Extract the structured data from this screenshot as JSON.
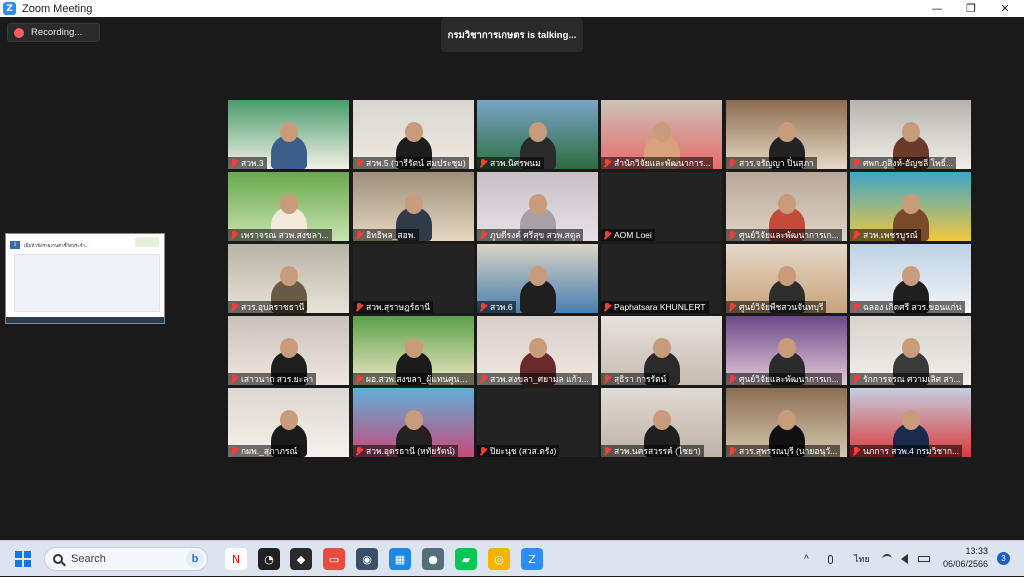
{
  "window": {
    "title": "Zoom Meeting",
    "logo_letter": "Z",
    "minimize": "—",
    "maximize": "❐",
    "close": "✕"
  },
  "recording": {
    "label": "Recording..."
  },
  "talking": {
    "text": "กรมวิชาการเกษตร is talking..."
  },
  "shared_screen": {
    "slide_number": "1",
    "slide_heading": "เพิ่มหัวข้อรายงานตัวชี้วัดประจำ..."
  },
  "tiles": [
    {
      "name": "สวพ.3"
    },
    {
      "name": "สวพ.5 (วารีรัตน์ สมประชุม)"
    },
    {
      "name": "สวพ.นิศรพนม"
    },
    {
      "name": "สำนักวิจัยและพัฒนาการ..."
    },
    {
      "name": "สวร.จรัญญา ปิ่นสุภา"
    },
    {
      "name": "ศพก.ภูสิงห์-อัญชลี โพธิ์..."
    },
    {
      "name": "เพราจรณ สวพ.สงขลา..."
    },
    {
      "name": "อิทธิพล_สอพ."
    },
    {
      "name": "ภูบดีรงค์ ศรีสุข สวพ.สตูล"
    },
    {
      "name": "AOM Loei"
    },
    {
      "name": "ศูนย์วิจัยและพัฒนาการเก..."
    },
    {
      "name": "สวพ.เพชรบูรณ์"
    },
    {
      "name": "สวร.อุบลราชธานี"
    },
    {
      "name": "สวพ.สุราษฎร์ธานี"
    },
    {
      "name": "สวพ.6"
    },
    {
      "name": "Paphatsara KHUNLERT"
    },
    {
      "name": "ศูนย์วิจัยพืชสวนจันทบุรี"
    },
    {
      "name": "ฉลอง เกิดศรี สวร.ขอนแก่น"
    },
    {
      "name": "เสาวนาถ สวร.ยะลา"
    },
    {
      "name": "ผอ.สวพ.สงขลา_ผู้แทนศูนย์..."
    },
    {
      "name": "สวพ.สงขลา_ศยามล แก้ว..."
    },
    {
      "name": "สุธิรา การรัตน์"
    },
    {
      "name": "ศูนย์วิจัยและพัฒนาการเก..."
    },
    {
      "name": "รักการจรณ ศวามเลิศ สา..."
    },
    {
      "name": "กผพ._สุภาภรณ์"
    },
    {
      "name": "สวพ.อุดรธานี (หทัยรัตน์)"
    },
    {
      "name": "ปิยะนุช (สวส.ตรัง)"
    },
    {
      "name": "สวพ.นครสวรรค์ (ไชยา)"
    },
    {
      "name": "สวร.สุพรรณบุรี (นายอนุวั..."
    },
    {
      "name": "นภการ สวพ.4 กรมวิชาก..."
    }
  ],
  "taskbar": {
    "search_placeholder": "Search",
    "bing_letter": "b",
    "language": "ไทย",
    "time": "13:33",
    "date": "06/06/2566",
    "notifications": "3",
    "tray_chevron": "^",
    "icons": [
      "widgets-icon",
      "netflix-icon",
      "speedtest-icon",
      "anydesk-icon",
      "monitor-icon",
      "edge-icon",
      "calculator-icon",
      "line-icon",
      "file-explorer-icon",
      "chrome-icon",
      "zoom-icon"
    ]
  }
}
